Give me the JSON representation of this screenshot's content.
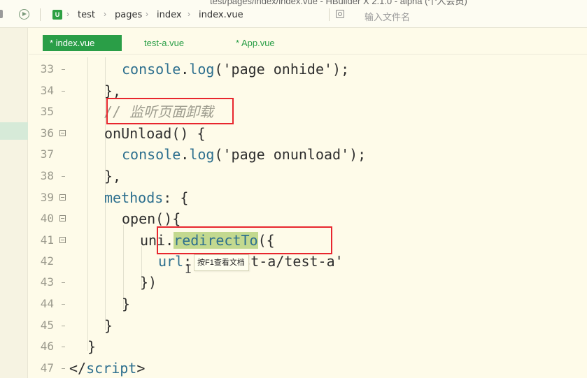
{
  "window": {
    "title_fragment": "test/pages/index/index.vue - HBuilder X 2.1.0 - alpha (个人会员)"
  },
  "breadcrumb": {
    "icon_letter": "U",
    "items": [
      "test",
      "pages",
      "index",
      "index.vue"
    ]
  },
  "search": {
    "placeholder": "输入文件名"
  },
  "tabs": [
    {
      "label": "* index.vue"
    },
    {
      "label": "test-a.vue"
    },
    {
      "label": "* App.vue"
    }
  ],
  "code_lines": [
    {
      "num": "33",
      "fold": "dash"
    },
    {
      "num": "34",
      "fold": "dash"
    },
    {
      "num": "35",
      "fold": "none"
    },
    {
      "num": "36",
      "fold": "box"
    },
    {
      "num": "37",
      "fold": "none"
    },
    {
      "num": "38",
      "fold": "dash"
    },
    {
      "num": "39",
      "fold": "box"
    },
    {
      "num": "40",
      "fold": "box"
    },
    {
      "num": "41",
      "fold": "box"
    },
    {
      "num": "42",
      "fold": "none"
    },
    {
      "num": "43",
      "fold": "dash"
    },
    {
      "num": "44",
      "fold": "dash"
    },
    {
      "num": "45",
      "fold": "dash"
    },
    {
      "num": "46",
      "fold": "dash"
    },
    {
      "num": "47",
      "fold": "dash"
    }
  ],
  "code": {
    "l33": {
      "a": "console",
      "b": ".",
      "c": "log",
      "d": "('page onhide');"
    },
    "l34": "},",
    "l35": "// 监听页面卸载",
    "l36": "onUnload() {",
    "l37": {
      "a": "console",
      "b": ".",
      "c": "log",
      "d": "('page onunload');"
    },
    "l38": "},",
    "l39": {
      "a": "methods",
      "b": ": {"
    },
    "l40": "open(){",
    "l41": {
      "a": "uni",
      "b": ".",
      "c": "redirectTo",
      "d": "({"
    },
    "l42": {
      "a": "url",
      "b": ":",
      "c": "st-a/test-a'"
    },
    "l43": "})",
    "l44": "}",
    "l45": "}",
    "l46": "}",
    "l47": {
      "a": "</",
      "b": "script",
      "c": ">"
    }
  },
  "tooltip": {
    "text": "按F1查看文档"
  },
  "colors": {
    "accent": "#2a9e47",
    "annotation": "#e8262e",
    "highlight": "#c3d98f",
    "background": "#fefbe9"
  }
}
